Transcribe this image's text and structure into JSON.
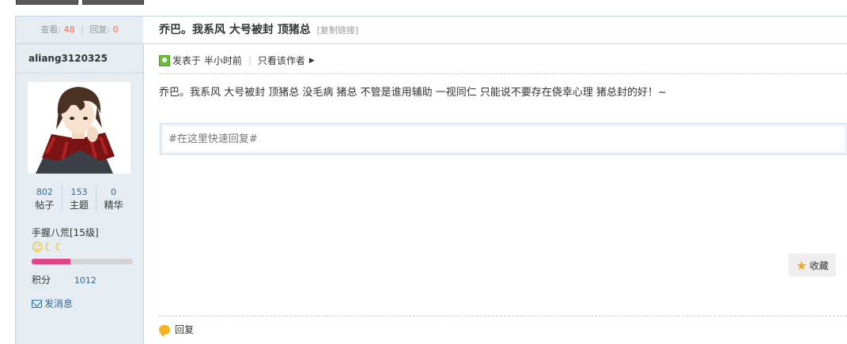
{
  "stats": {
    "views_label": "查看:",
    "views": "48",
    "replies_label": "回复:",
    "replies": "0"
  },
  "author": {
    "username": "aliang3120325",
    "counts": [
      {
        "value": "802",
        "label": "帖子"
      },
      {
        "value": "153",
        "label": "主题"
      },
      {
        "value": "0",
        "label": "精华"
      }
    ],
    "rank": "手握八荒[15级]",
    "level_icons": [
      "smile-icon",
      "moon-icon",
      "moon-icon"
    ],
    "level_progress_percent": 38,
    "points_label": "积分",
    "points": "1012",
    "send_message": "发消息"
  },
  "post": {
    "title": "乔巴。我系风 大号被封 顶猪总",
    "copy_link": "[复制链接]",
    "posted_time": "发表于 半小时前",
    "only_author": "只看该作者",
    "content": "乔巴。我系风  大号被封  顶猪总  没毛病  猪总  不管是谁用辅助 一视同仁  只能说不要存在侥幸心理  猪总封的好！~",
    "quick_reply_placeholder": "#在这里快速回复#",
    "favorite": "收藏",
    "reply": "回复"
  },
  "colors": {
    "sidebar_bg": "#e5edf2",
    "link": "#336699",
    "count_accent": "#f26c4f",
    "progress": "#e0458a"
  }
}
